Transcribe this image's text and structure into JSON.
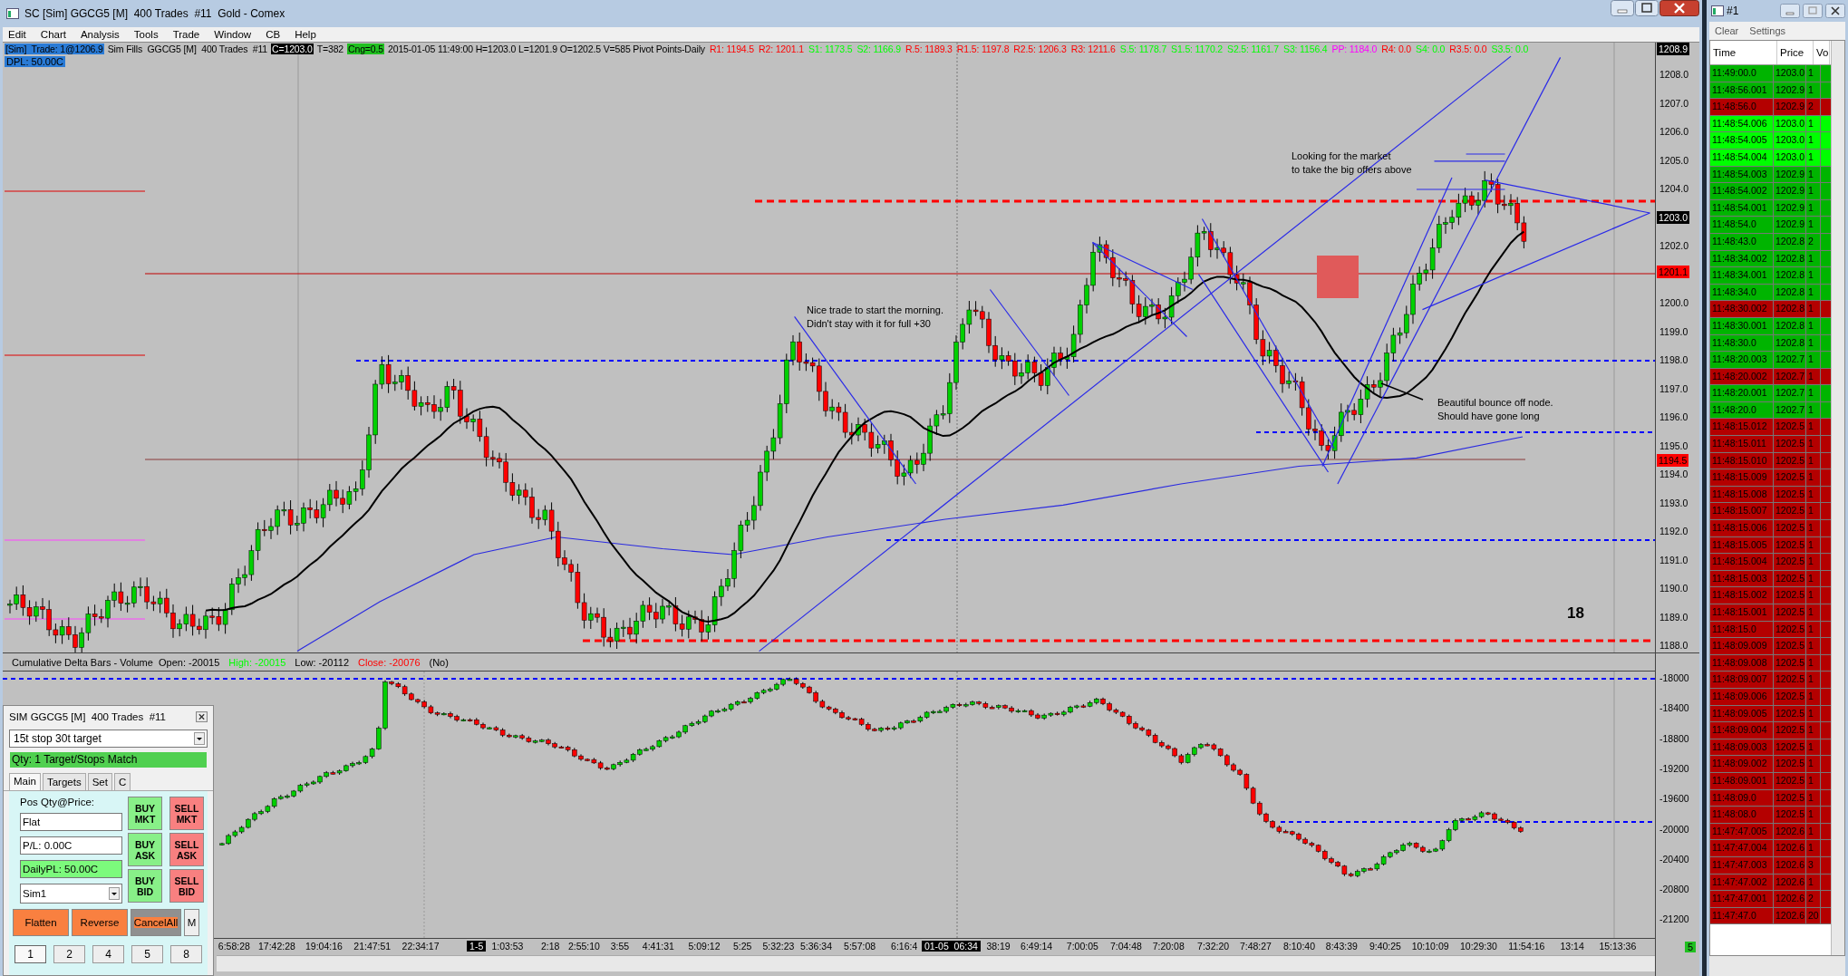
{
  "window": {
    "title": "SC [Sim] GGCG5 [M]  400 Trades  #11  Gold - Comex"
  },
  "menu": [
    "Edit",
    "Chart",
    "Analysis",
    "Tools",
    "Trade",
    "Window",
    "CB",
    "Help"
  ],
  "chart": {
    "header": [
      {
        "text": "[Sim]  Trade: 1@1206.9",
        "kind": "highlight"
      },
      {
        "text": "Sim Fills  GGCG5 [M]  400 Trades  #11",
        "kind": "plain"
      },
      {
        "text": "C=1203.0",
        "kind": "inverse"
      },
      {
        "text": "T=382",
        "kind": "plain"
      },
      {
        "text": "Cng=0.5",
        "kind": "badge"
      },
      {
        "text": "2015-01-05 11:49:00 H=1203.0 L=1201.9 O=1202.5 V=585 Pivot Points-Daily",
        "kind": "plain"
      }
    ],
    "pivots": [
      {
        "text": "R1: 1194.5",
        "color": "#ff0000"
      },
      {
        "text": "R2: 1201.1",
        "color": "#ff0000"
      },
      {
        "text": "S1: 1173.5",
        "color": "#00ff00"
      },
      {
        "text": "S2: 1166.9",
        "color": "#00ff00"
      },
      {
        "text": "R.5: 1189.3",
        "color": "#ff0000"
      },
      {
        "text": "R1.5: 1197.8",
        "color": "#ff0000"
      },
      {
        "text": "R2.5: 1206.3",
        "color": "#ff0000"
      },
      {
        "text": "R3: 1211.6",
        "color": "#ff0000"
      },
      {
        "text": "S.5: 1178.7",
        "color": "#00ff00"
      },
      {
        "text": "S1.5: 1170.2",
        "color": "#00ff00"
      },
      {
        "text": "S2.5: 1161.7",
        "color": "#00ff00"
      },
      {
        "text": "S3: 1156.4",
        "color": "#00ff00"
      },
      {
        "text": "PP: 1184.0",
        "color": "#ff00ff"
      },
      {
        "text": "R4: 0.0",
        "color": "#ff0000"
      },
      {
        "text": "S4: 0.0",
        "color": "#00ff00"
      },
      {
        "text": "R3.5: 0.0",
        "color": "#ff0000"
      },
      {
        "text": "S3.5: 0.0",
        "color": "#00ff00"
      }
    ],
    "dpl": "DPL: 50.00C",
    "price_axis": [
      "1208.0",
      "1207.0",
      "1206.0",
      "1205.0",
      "1204.0",
      "1202.0",
      "1200.0",
      "1199.0",
      "1198.0",
      "1197.0",
      "1196.0",
      "1195.0",
      "1194.0",
      "1193.0",
      "1192.0",
      "1191.0",
      "1190.0",
      "1189.0",
      "1188.0"
    ],
    "price_tags": [
      {
        "text": "1208.9",
        "kind": "last"
      },
      {
        "text": "1203.0",
        "kind": "last"
      },
      {
        "text": "1201.1",
        "kind": "pivot"
      },
      {
        "text": "1194.5",
        "kind": "pivot"
      }
    ],
    "annotations": [
      "Looking for the market\nto take the big offers above",
      "Nice trade to start the morning.\nDidn't stay with it for full +30",
      "Beautiful bounce off node.\nShould have gone long"
    ],
    "bar_count": "18"
  },
  "delta": {
    "header": [
      {
        "text": "Cumulative Delta Bars - Volume  Open: -20015",
        "kind": "plain"
      },
      {
        "text": "High: -20015",
        "kind": "high"
      },
      {
        "text": "Low: -20112",
        "kind": "plain"
      },
      {
        "text": "Close: -20076",
        "kind": "low"
      },
      {
        "text": "(No)",
        "kind": "plain"
      }
    ],
    "axis": [
      "-18000",
      "-18400",
      "-18800",
      "-19200",
      "-19600",
      "-20000",
      "-20400",
      "-20800",
      "-21200"
    ]
  },
  "time_axis": [
    {
      "text": "6:58:28",
      "kind": "plain"
    },
    {
      "text": "17:42:28",
      "kind": "plain"
    },
    {
      "text": "19:04:16",
      "kind": "plain"
    },
    {
      "text": "21:47:51",
      "kind": "plain"
    },
    {
      "text": "22:34:17",
      "kind": "plain"
    },
    {
      "text": "1-5",
      "kind": "date"
    },
    {
      "text": "1:03:53",
      "kind": "plain"
    },
    {
      "text": "2:18",
      "kind": "plain"
    },
    {
      "text": "2:55:10",
      "kind": "plain"
    },
    {
      "text": "3:55",
      "kind": "plain"
    },
    {
      "text": "4:41:31",
      "kind": "plain"
    },
    {
      "text": "5:09:12",
      "kind": "plain"
    },
    {
      "text": "5:25",
      "kind": "plain"
    },
    {
      "text": "5:32:23",
      "kind": "plain"
    },
    {
      "text": "5:36:34",
      "kind": "plain"
    },
    {
      "text": "5:57:08",
      "kind": "plain"
    },
    {
      "text": "6:16:4",
      "kind": "plain"
    },
    {
      "text": "01-05  06:34",
      "kind": "date"
    },
    {
      "text": "38:19",
      "kind": "plain"
    },
    {
      "text": "6:49:14",
      "kind": "plain"
    },
    {
      "text": "7:00:05",
      "kind": "plain"
    },
    {
      "text": "7:04:48",
      "kind": "plain"
    },
    {
      "text": "7:20:08",
      "kind": "plain"
    },
    {
      "text": "7:32:20",
      "kind": "plain"
    },
    {
      "text": "7:48:27",
      "kind": "plain"
    },
    {
      "text": "8:10:40",
      "kind": "plain"
    },
    {
      "text": "8:43:39",
      "kind": "plain"
    },
    {
      "text": "9:40:25",
      "kind": "plain"
    },
    {
      "text": "10:10:09",
      "kind": "plain"
    },
    {
      "text": "10:29:30",
      "kind": "plain"
    },
    {
      "text": "11:54:16",
      "kind": "plain"
    },
    {
      "text": "13:14",
      "kind": "plain"
    },
    {
      "text": "15:13:36",
      "kind": "plain"
    }
  ],
  "corner_badge": "5",
  "order_panel": {
    "title": "SIM GGCG5 [M]  400 Trades  #11",
    "strategy": "15t stop 30t target",
    "status": "Qty: 1 Target/Stops Match",
    "tabs": [
      {
        "label": "Main",
        "selected": true
      },
      {
        "label": "Targets",
        "selected": false
      },
      {
        "label": "Set",
        "selected": false
      },
      {
        "label": "C",
        "selected": false
      }
    ],
    "position_label": "Pos Qty@Price:",
    "position": "Flat",
    "pl": "P/L: 0.00C",
    "daily_pl": "DailyPL: 50.00C",
    "account": "Sim1",
    "orders": [
      {
        "label": "BUY\nMKT",
        "kind": "buy"
      },
      {
        "label": "SELL\nMKT",
        "kind": "sell"
      },
      {
        "label": "BUY\nASK",
        "kind": "buy"
      },
      {
        "label": "SELL\nASK",
        "kind": "sell"
      },
      {
        "label": "BUY\nBID",
        "kind": "buy"
      },
      {
        "label": "SELL\nBID",
        "kind": "sell"
      }
    ],
    "actions": [
      {
        "label": "Flatten",
        "kind": "action"
      },
      {
        "label": "Reverse",
        "kind": "action"
      },
      {
        "label": "CancelAll",
        "kind": "cancel"
      },
      {
        "label": "M",
        "kind": "small"
      }
    ],
    "quantities": [
      {
        "label": "1",
        "selected": true
      },
      {
        "label": "2",
        "selected": false
      },
      {
        "label": "4",
        "selected": false
      },
      {
        "label": "5",
        "selected": false
      },
      {
        "label": "8",
        "selected": false
      }
    ]
  },
  "time_and_sales": {
    "title": "#1",
    "menu": [
      "Clear",
      "Settings"
    ],
    "columns": [
      "Time",
      "Price",
      "Vo"
    ],
    "rows": [
      {
        "time": "11:49:00.0",
        "price": "1203.0",
        "volume": "1",
        "color": "#00b400"
      },
      {
        "time": "11:48:56.001",
        "price": "1202.9",
        "volume": "1",
        "color": "#00b400"
      },
      {
        "time": "11:48:56.0",
        "price": "1202.9",
        "volume": "2",
        "color": "#b40000"
      },
      {
        "time": "11:48:54.006",
        "price": "1203.0",
        "volume": "1",
        "color": "#00ff00"
      },
      {
        "time": "11:48:54.005",
        "price": "1203.0",
        "volume": "1",
        "color": "#00ff00"
      },
      {
        "time": "11:48:54.004",
        "price": "1203.0",
        "volume": "1",
        "color": "#00ff00"
      },
      {
        "time": "11:48:54.003",
        "price": "1202.9",
        "volume": "1",
        "color": "#00b400"
      },
      {
        "time": "11:48:54.002",
        "price": "1202.9",
        "volume": "1",
        "color": "#00b400"
      },
      {
        "time": "11:48:54.001",
        "price": "1202.9",
        "volume": "1",
        "color": "#00b400"
      },
      {
        "time": "11:48:54.0",
        "price": "1202.9",
        "volume": "1",
        "color": "#00b400"
      },
      {
        "time": "11:48:43.0",
        "price": "1202.8",
        "volume": "2",
        "color": "#00b400"
      },
      {
        "time": "11:48:34.002",
        "price": "1202.8",
        "volume": "1",
        "color": "#00b400"
      },
      {
        "time": "11:48:34.001",
        "price": "1202.8",
        "volume": "1",
        "color": "#00b400"
      },
      {
        "time": "11:48:34.0",
        "price": "1202.8",
        "volume": "1",
        "color": "#00b400"
      },
      {
        "time": "11:48:30.002",
        "price": "1202.8",
        "volume": "1",
        "color": "#b40000"
      },
      {
        "time": "11:48:30.001",
        "price": "1202.8",
        "volume": "1",
        "color": "#00b400"
      },
      {
        "time": "11:48:30.0",
        "price": "1202.8",
        "volume": "1",
        "color": "#00b400"
      },
      {
        "time": "11:48:20.003",
        "price": "1202.7",
        "volume": "1",
        "color": "#00b400"
      },
      {
        "time": "11:48:20.002",
        "price": "1202.7",
        "volume": "1",
        "color": "#b40000"
      },
      {
        "time": "11:48:20.001",
        "price": "1202.7",
        "volume": "1",
        "color": "#00b400"
      },
      {
        "time": "11:48:20.0",
        "price": "1202.7",
        "volume": "1",
        "color": "#00b400"
      },
      {
        "time": "11:48:15.012",
        "price": "1202.5",
        "volume": "1",
        "color": "#b40000"
      },
      {
        "time": "11:48:15.011",
        "price": "1202.5",
        "volume": "1",
        "color": "#b40000"
      },
      {
        "time": "11:48:15.010",
        "price": "1202.5",
        "volume": "1",
        "color": "#b40000"
      },
      {
        "time": "11:48:15.009",
        "price": "1202.5",
        "volume": "1",
        "color": "#b40000"
      },
      {
        "time": "11:48:15.008",
        "price": "1202.5",
        "volume": "1",
        "color": "#b40000"
      },
      {
        "time": "11:48:15.007",
        "price": "1202.5",
        "volume": "1",
        "color": "#b40000"
      },
      {
        "time": "11:48:15.006",
        "price": "1202.5",
        "volume": "1",
        "color": "#b40000"
      },
      {
        "time": "11:48:15.005",
        "price": "1202.5",
        "volume": "1",
        "color": "#b40000"
      },
      {
        "time": "11:48:15.004",
        "price": "1202.5",
        "volume": "1",
        "color": "#b40000"
      },
      {
        "time": "11:48:15.003",
        "price": "1202.5",
        "volume": "1",
        "color": "#b40000"
      },
      {
        "time": "11:48:15.002",
        "price": "1202.5",
        "volume": "1",
        "color": "#b40000"
      },
      {
        "time": "11:48:15.001",
        "price": "1202.5",
        "volume": "1",
        "color": "#b40000"
      },
      {
        "time": "11:48:15.0",
        "price": "1202.5",
        "volume": "1",
        "color": "#b40000"
      },
      {
        "time": "11:48:09.009",
        "price": "1202.5",
        "volume": "1",
        "color": "#b40000"
      },
      {
        "time": "11:48:09.008",
        "price": "1202.5",
        "volume": "1",
        "color": "#b40000"
      },
      {
        "time": "11:48:09.007",
        "price": "1202.5",
        "volume": "1",
        "color": "#b40000"
      },
      {
        "time": "11:48:09.006",
        "price": "1202.5",
        "volume": "1",
        "color": "#b40000"
      },
      {
        "time": "11:48:09.005",
        "price": "1202.5",
        "volume": "1",
        "color": "#b40000"
      },
      {
        "time": "11:48:09.004",
        "price": "1202.5",
        "volume": "1",
        "color": "#b40000"
      },
      {
        "time": "11:48:09.003",
        "price": "1202.5",
        "volume": "1",
        "color": "#b40000"
      },
      {
        "time": "11:48:09.002",
        "price": "1202.5",
        "volume": "1",
        "color": "#b40000"
      },
      {
        "time": "11:48:09.001",
        "price": "1202.5",
        "volume": "1",
        "color": "#b40000"
      },
      {
        "time": "11:48:09.0",
        "price": "1202.5",
        "volume": "1",
        "color": "#b40000"
      },
      {
        "time": "11:48:08.0",
        "price": "1202.5",
        "volume": "1",
        "color": "#b40000"
      },
      {
        "time": "11:47:47.005",
        "price": "1202.6",
        "volume": "1",
        "color": "#b40000"
      },
      {
        "time": "11:47:47.004",
        "price": "1202.6",
        "volume": "1",
        "color": "#b40000"
      },
      {
        "time": "11:47:47.003",
        "price": "1202.6",
        "volume": "3",
        "color": "#b40000"
      },
      {
        "time": "11:47:47.002",
        "price": "1202.6",
        "volume": "1",
        "color": "#b40000"
      },
      {
        "time": "11:47:47.001",
        "price": "1202.6",
        "volume": "2",
        "color": "#b40000"
      },
      {
        "time": "11:47:47.0",
        "price": "1202.6",
        "volume": "20",
        "color": "#b40000"
      }
    ]
  }
}
